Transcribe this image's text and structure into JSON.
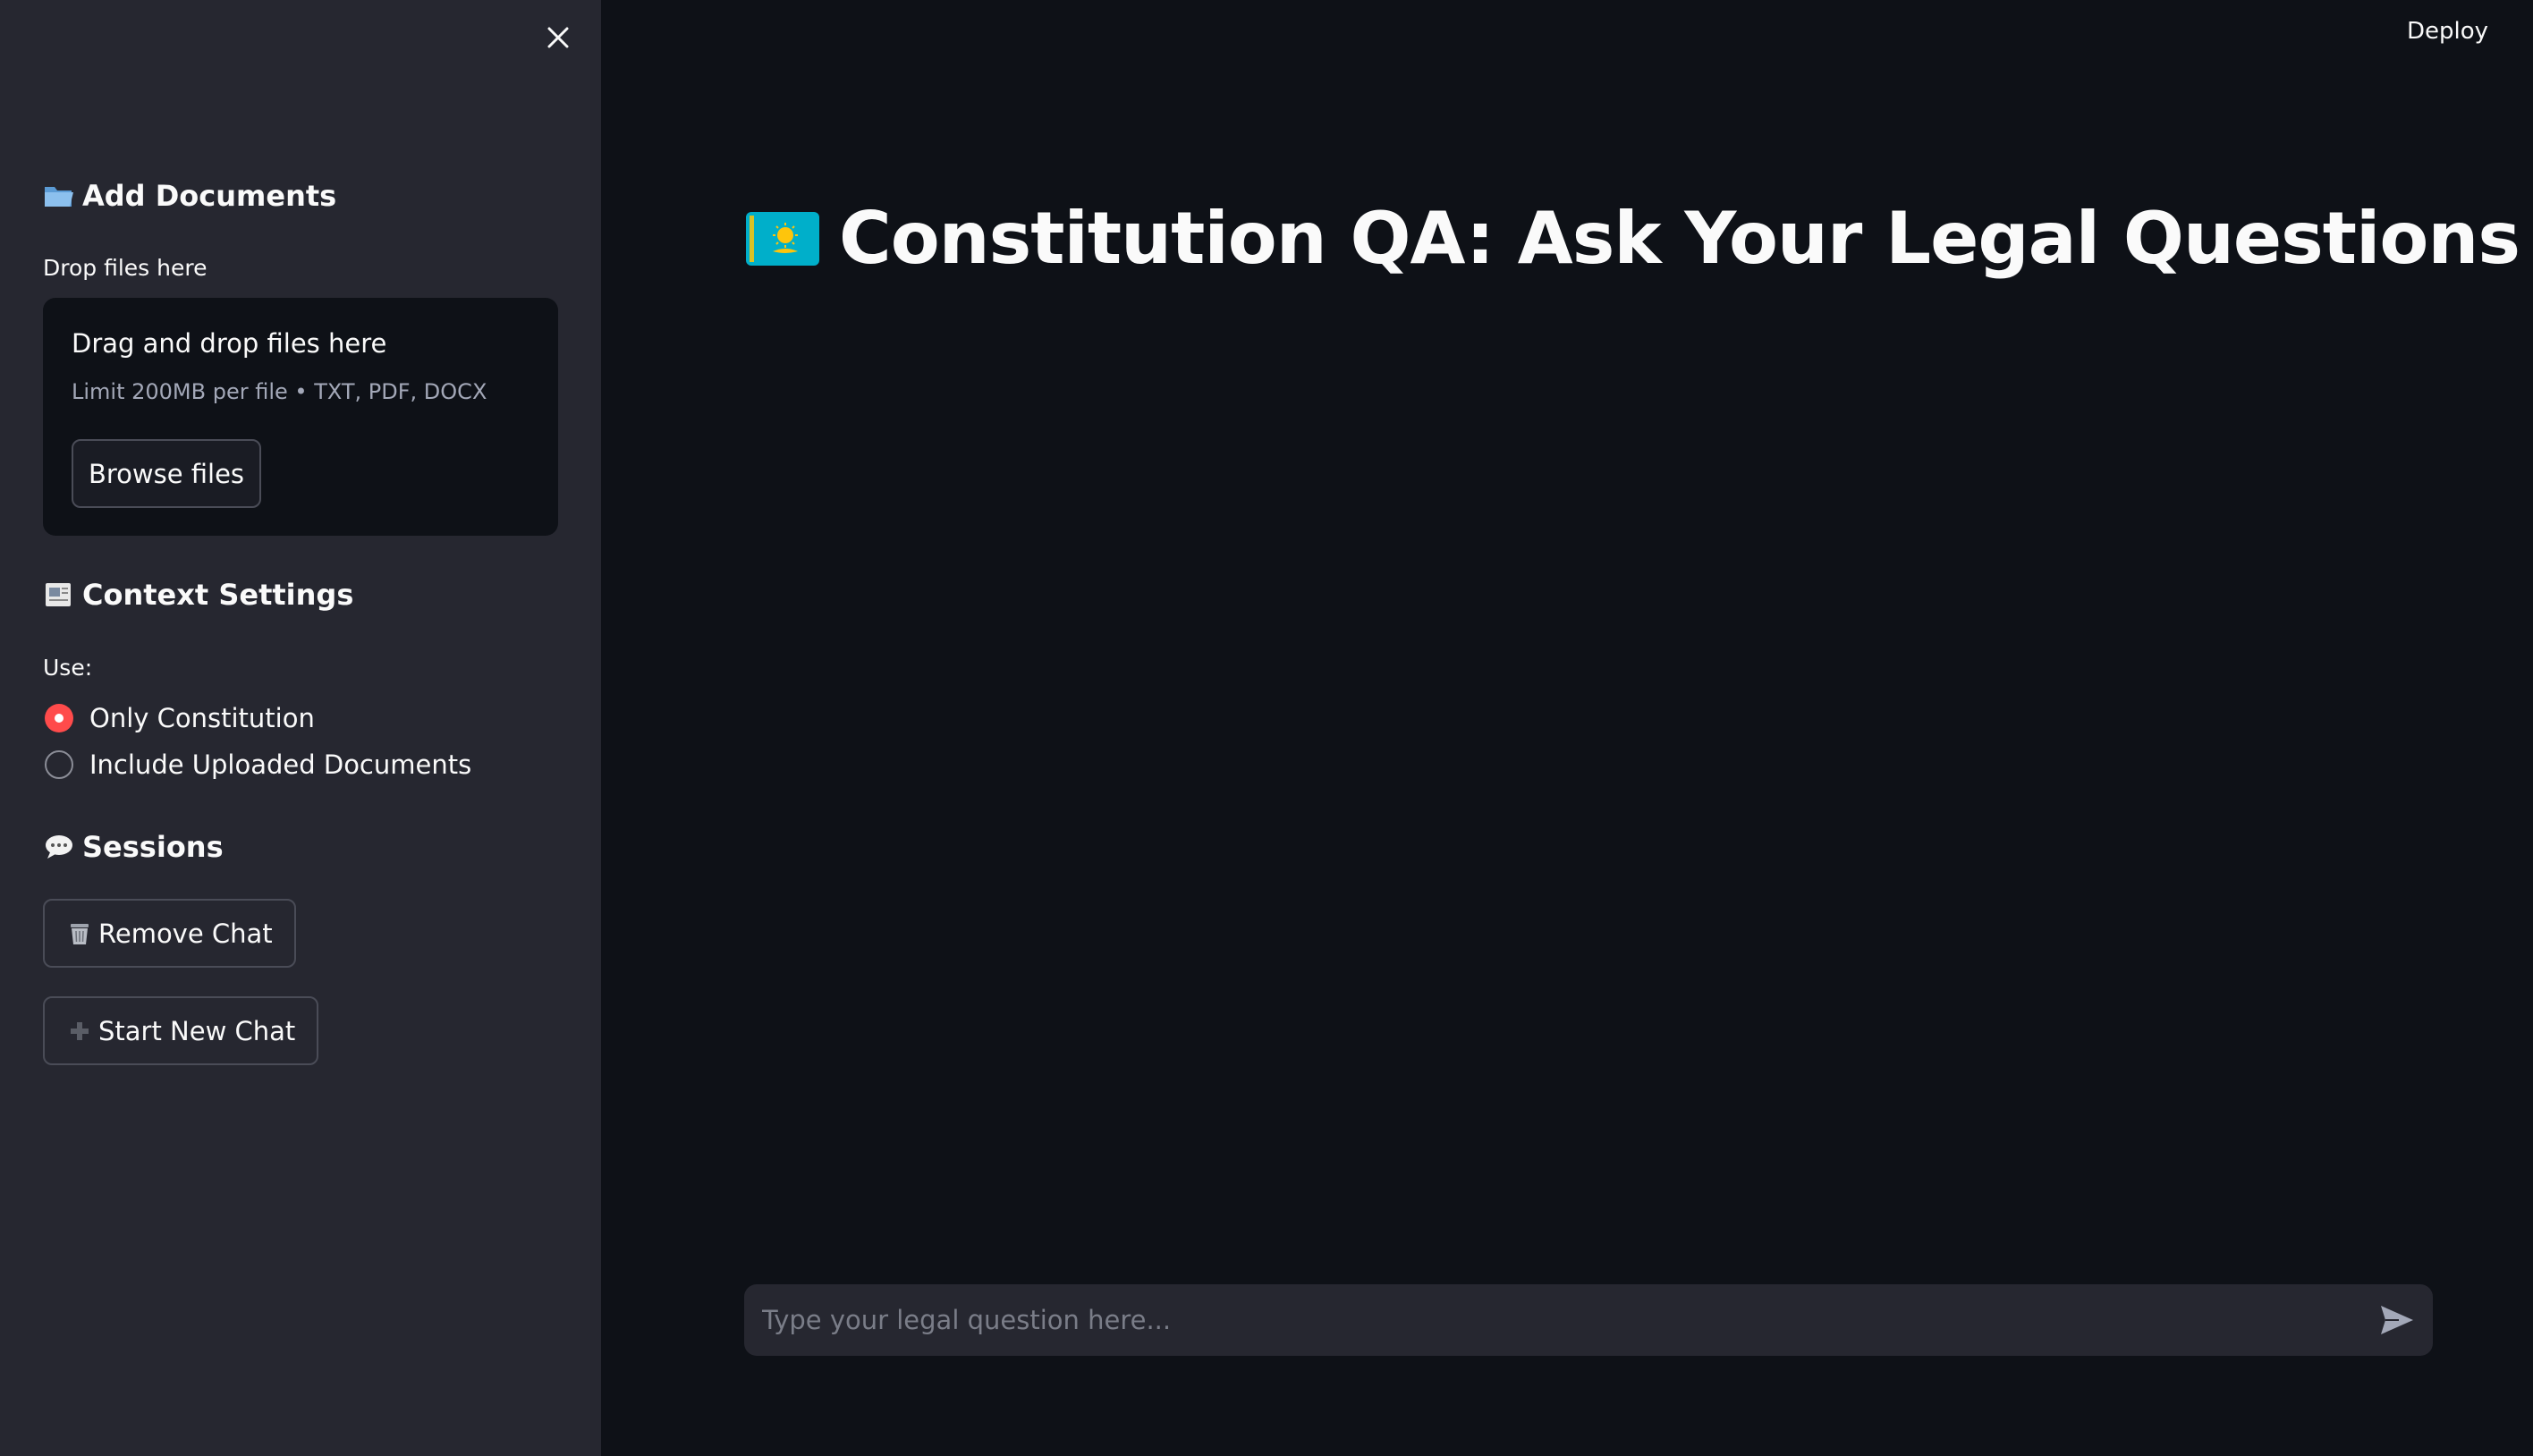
{
  "sidebar": {
    "add_documents": {
      "title": "Add Documents",
      "icon": "folder-icon",
      "drop_label": "Drop files here",
      "dropzone_title": "Drag and drop files here",
      "dropzone_limit": "Limit 200MB per file • TXT, PDF, DOCX",
      "browse_label": "Browse files"
    },
    "context_settings": {
      "title": "Context Settings",
      "icon": "document-icon",
      "use_label": "Use:",
      "options": [
        {
          "label": "Only Constitution",
          "selected": true
        },
        {
          "label": "Include Uploaded Documents",
          "selected": false
        }
      ]
    },
    "sessions": {
      "title": "Sessions",
      "icon": "speech-bubble-icon",
      "remove_label": "Remove Chat",
      "new_label": "Start New Chat"
    }
  },
  "header": {
    "deploy_label": "Deploy"
  },
  "main": {
    "title": "Constitution QA: Ask Your Legal Questions",
    "title_icon": "kazakhstan-flag-icon"
  },
  "chat": {
    "placeholder": "Type your legal question here...",
    "value": ""
  },
  "colors": {
    "sidebar_bg": "#262730",
    "main_bg": "#0e1117",
    "accent": "#ff4b4b",
    "flag_blue": "#00afca",
    "flag_gold": "#fec50c"
  }
}
